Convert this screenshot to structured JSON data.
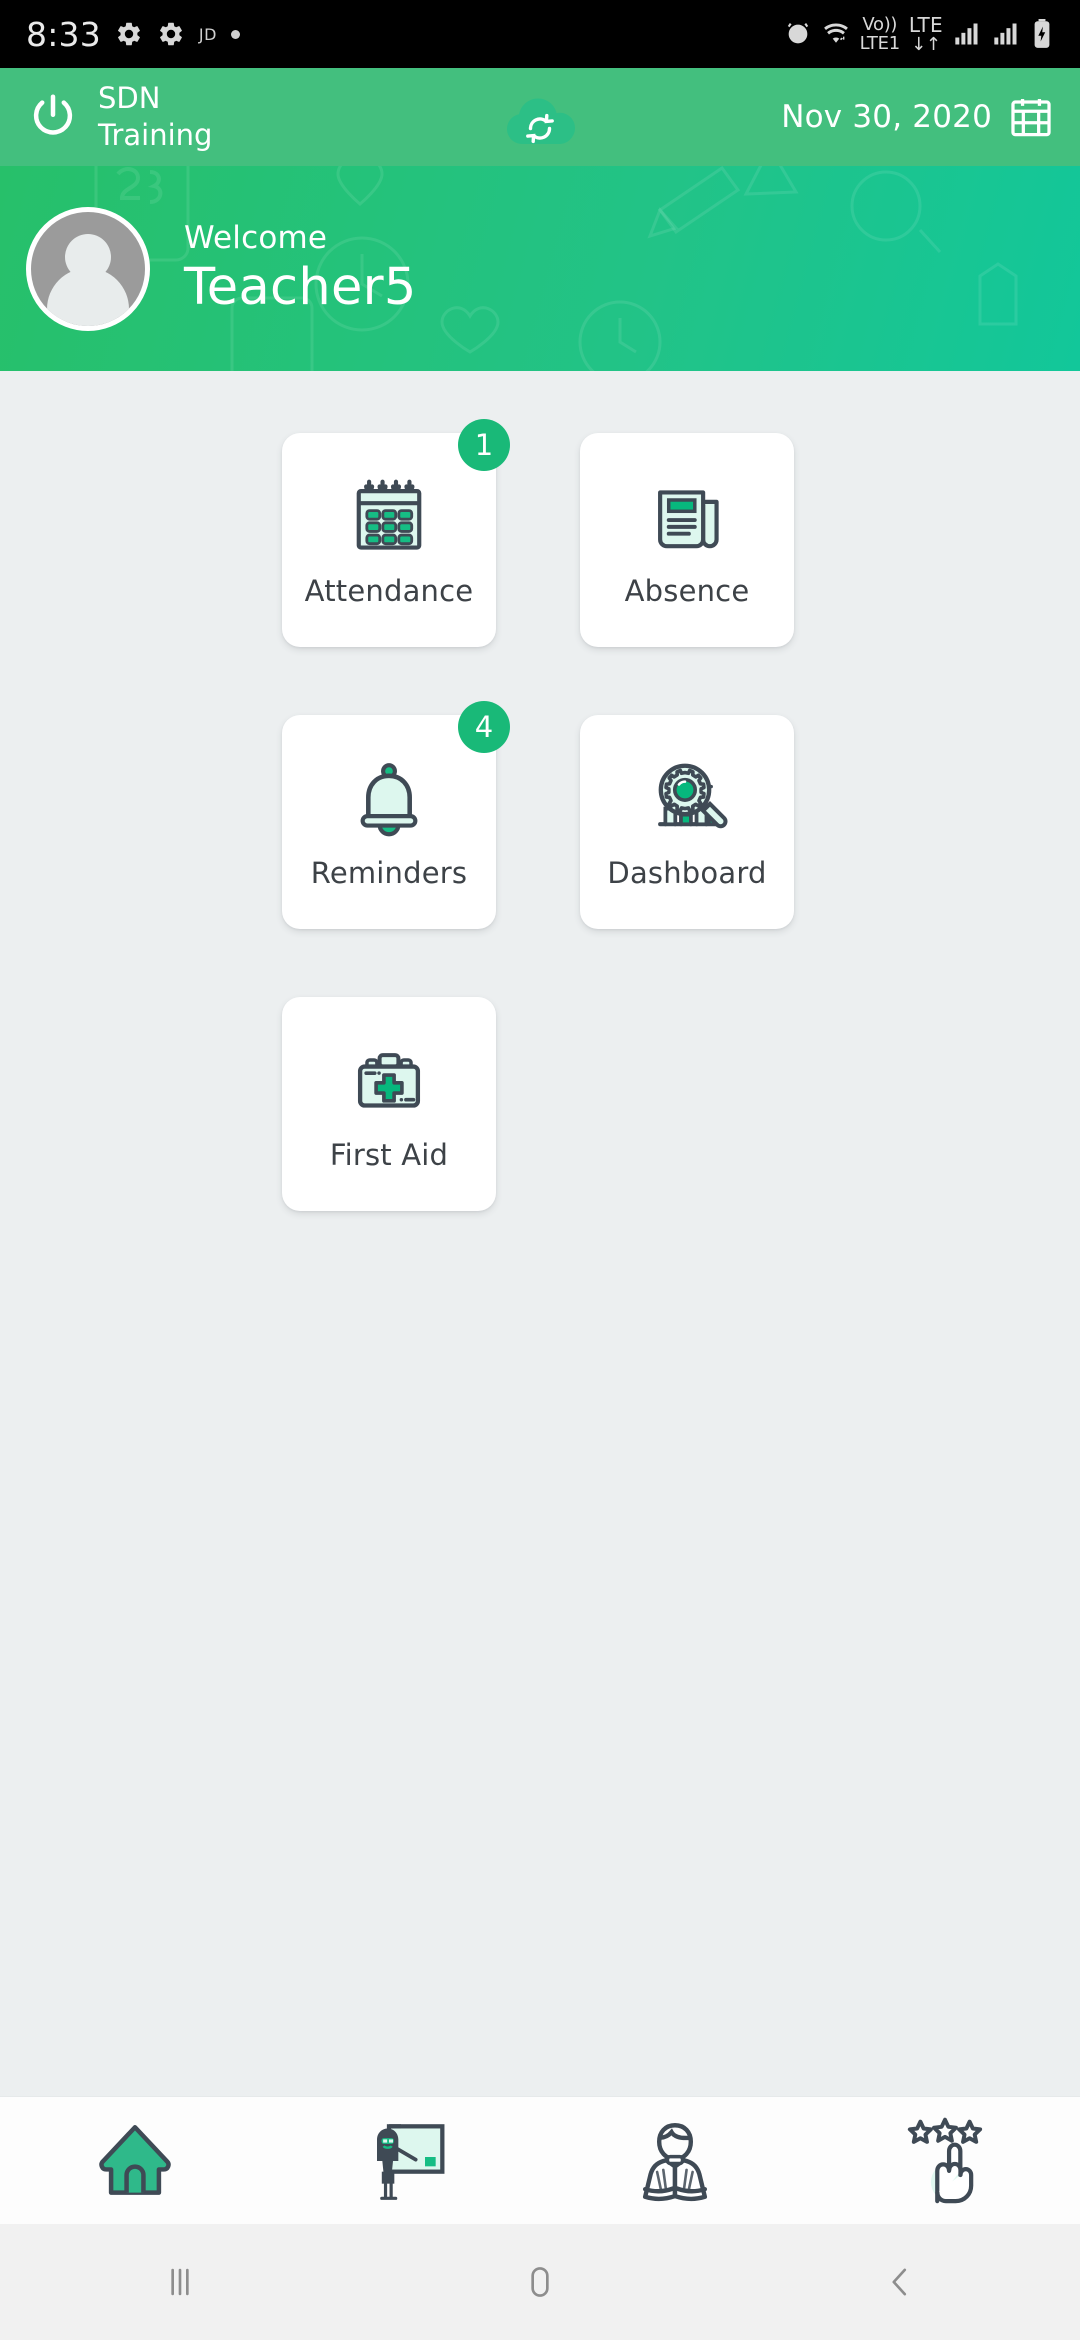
{
  "statusbar": {
    "time": "8:33",
    "left_icons": [
      "gear-icon",
      "gear-icon"
    ],
    "left_badge_text": "JD",
    "left_dot": "dot-indicator",
    "right_icons": [
      "alarm-icon",
      "wifi-icon",
      "signal-bars-icon",
      "signal-bars-icon",
      "battery-charging-icon"
    ],
    "volte_top": "Vo))",
    "volte_bottom": "LTE1",
    "lte_label": "LTE",
    "lte_arrows": "↓↑",
    "volte_arrows": "↓↑"
  },
  "appbar": {
    "power_icon": "power-icon",
    "title": "SDN\nTraining",
    "sync_icon": "cloud-sync-icon",
    "date": "Nov 30, 2020",
    "calendar_icon": "calendar-icon"
  },
  "welcome": {
    "greeting": "Welcome",
    "name": "Teacher5",
    "avatar_icon": "avatar-placeholder"
  },
  "grid": {
    "cards": [
      {
        "id": "attendance",
        "label": "Attendance",
        "icon": "calendar-icon",
        "badge": "1"
      },
      {
        "id": "absence",
        "label": "Absence",
        "icon": "newspaper-icon",
        "badge": null
      },
      {
        "id": "reminders",
        "label": "Reminders",
        "icon": "bell-icon",
        "badge": "4"
      },
      {
        "id": "dashboard",
        "label": "Dashboard",
        "icon": "magnifier-gear-chart-icon",
        "badge": null
      },
      {
        "id": "firstaid",
        "label": "First Aid",
        "icon": "first-aid-kit-icon",
        "badge": null
      }
    ]
  },
  "bottomnav": {
    "items": [
      {
        "id": "home",
        "icon": "home-icon",
        "active": true
      },
      {
        "id": "teacher",
        "icon": "teacher-board-icon",
        "active": false
      },
      {
        "id": "student",
        "icon": "student-reading-icon",
        "active": false
      },
      {
        "id": "rating",
        "icon": "hand-stars-icon",
        "active": false
      }
    ]
  },
  "sysnav": {
    "recents": "recents-icon",
    "home": "home-pill-icon",
    "back": "back-chevron-icon"
  },
  "colors": {
    "appbar_green": "#43bf7e",
    "banner_green": "#22c387",
    "accent_green": "#19b978",
    "icon_mint": "#d9f7ee",
    "icon_outline": "#3f4a55",
    "page_bg": "#eceff0"
  }
}
